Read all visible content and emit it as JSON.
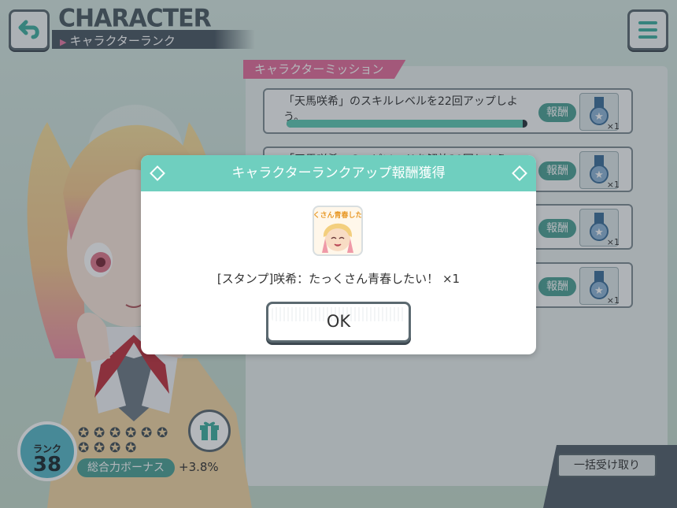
{
  "header": {
    "title": "CHARACTER",
    "subtitle": "キャラクターランク"
  },
  "missions": {
    "tab_label": "キャラクターミッション",
    "items": [
      {
        "text": "「天馬咲希」のスキルレベルを22回アップしよう。",
        "progress": 0.98,
        "reward_label": "報酬",
        "reward_count": "×1"
      },
      {
        "text": "「天馬咲希」のエピソードを解放30回しよう",
        "progress": 0,
        "reward_label": "報酬",
        "reward_count": "×1"
      },
      {
        "text": "",
        "progress": 0,
        "reward_label": "報酬",
        "reward_count": "×1"
      },
      {
        "text": "",
        "progress": 0,
        "reward_label": "報酬",
        "reward_count": "×1"
      }
    ],
    "bulk_receive": "一括受け取り"
  },
  "rank": {
    "label": "ランク",
    "value": "38",
    "bonus_label": "総合力ボーナス",
    "bonus_value": "+3.8%"
  },
  "dialog": {
    "title": "キャラクターランクアップ報酬獲得",
    "stamp_text": "たっくさん青春したい！",
    "reward_text": "[スタンプ]咲希：たっくさん青春したい！ ×1",
    "ok_label": "OK"
  },
  "icons": [
    "back-arrow-icon",
    "menu-icon",
    "medal-icon",
    "gift-icon",
    "star-icon",
    "diamond-icon"
  ],
  "colors": {
    "accent": "#6fcfbf",
    "pink": "#e56d9b",
    "dark": "#4b5a62",
    "pill": "#4da196"
  }
}
